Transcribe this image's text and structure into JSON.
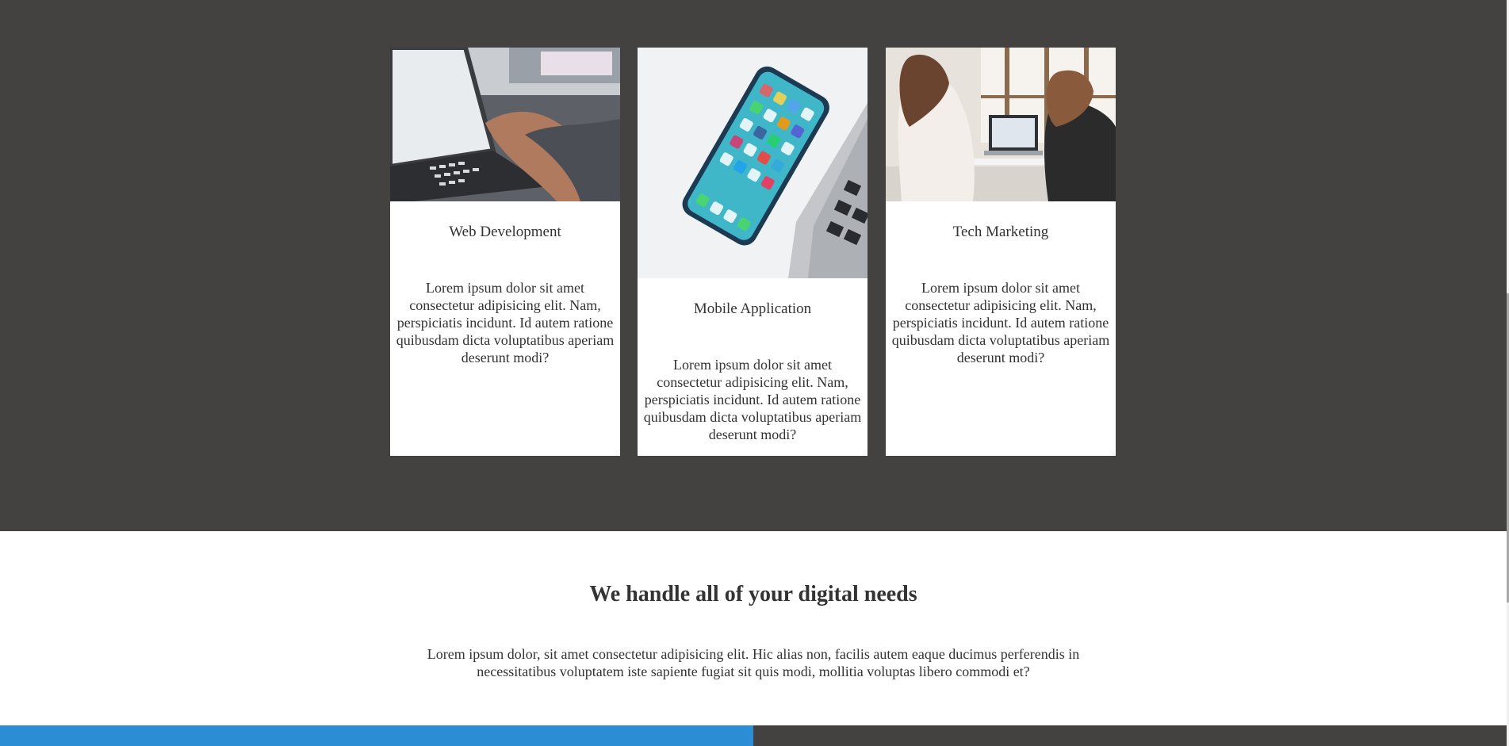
{
  "services": {
    "cards": [
      {
        "image": "laptop-typing-photo",
        "title": "Web Development",
        "text": "Lorem ipsum dolor sit amet consectetur adipisicing elit. Nam, perspiciatis incidunt. Id autem ratione quibusdam dicta voluptatibus aperiam deserunt modi?"
      },
      {
        "image": "smartphone-photo",
        "title": "Mobile Application",
        "text": "Lorem ipsum dolor sit amet consectetur adipisicing elit. Nam, perspiciatis incidunt. Id autem ratione quibusdam dicta voluptatibus aperiam deserunt modi?"
      },
      {
        "image": "two-women-laptop-photo",
        "title": "Tech Marketing",
        "text": "Lorem ipsum dolor sit amet consectetur adipisicing elit. Nam, perspiciatis incidunt. Id autem ratione quibusdam dicta voluptatibus aperiam deserunt modi?"
      }
    ]
  },
  "about": {
    "title": "We handle all of your digital needs",
    "text": "Lorem ipsum dolor, sit amet consectetur adipisicing elit. Hic alias non, facilis autem eaque ducimus perferendis in necessitatibus voluptatem iste sapiente fugiat sit quis modi, mollitia voluptas libero commodi et?"
  },
  "colors": {
    "section_dark": "#444240",
    "accent_blue": "#2b8ed4",
    "text": "#333333"
  }
}
